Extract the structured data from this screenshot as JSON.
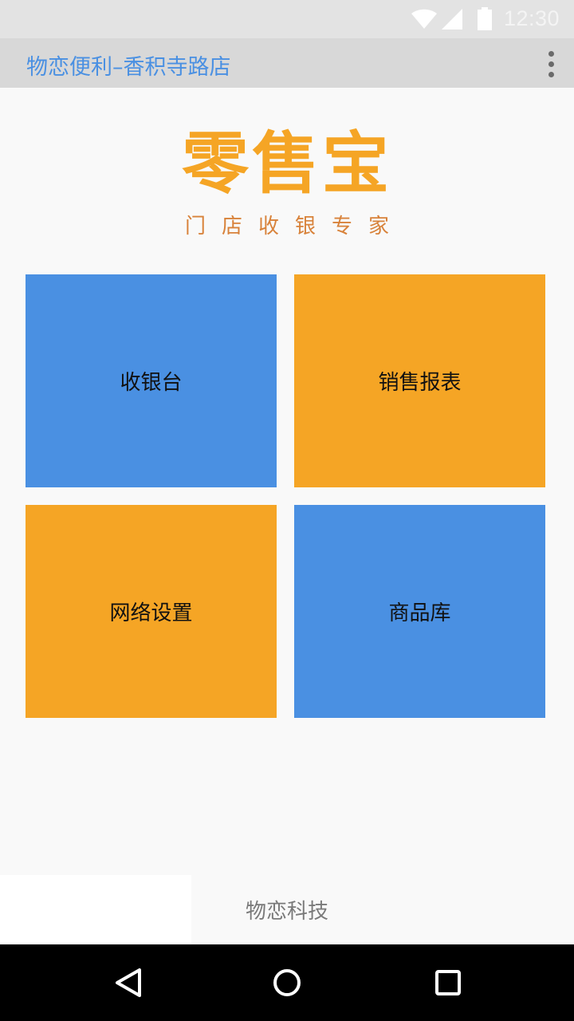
{
  "status_bar": {
    "time": "12:30",
    "icons": [
      "wifi-icon",
      "signal-icon",
      "battery-icon"
    ]
  },
  "app_bar": {
    "title": "物恋便利–香积寺路店",
    "menu_icon": "overflow-menu-icon"
  },
  "logo": {
    "title": "零售宝",
    "subtitle": "门店收银专家"
  },
  "tiles": [
    {
      "label": "收银台",
      "color": "#4a90e2"
    },
    {
      "label": "销售报表",
      "color": "#f5a525"
    },
    {
      "label": "网络设置",
      "color": "#f5a525"
    },
    {
      "label": "商品库",
      "color": "#4a90e2"
    }
  ],
  "footer": {
    "text": "物恋科技"
  },
  "nav_bar": {
    "buttons": [
      "back-icon",
      "home-icon",
      "recents-icon"
    ]
  },
  "colors": {
    "accent_blue": "#4a90e2",
    "accent_orange": "#f5a525",
    "background": "#f9f9f9"
  }
}
